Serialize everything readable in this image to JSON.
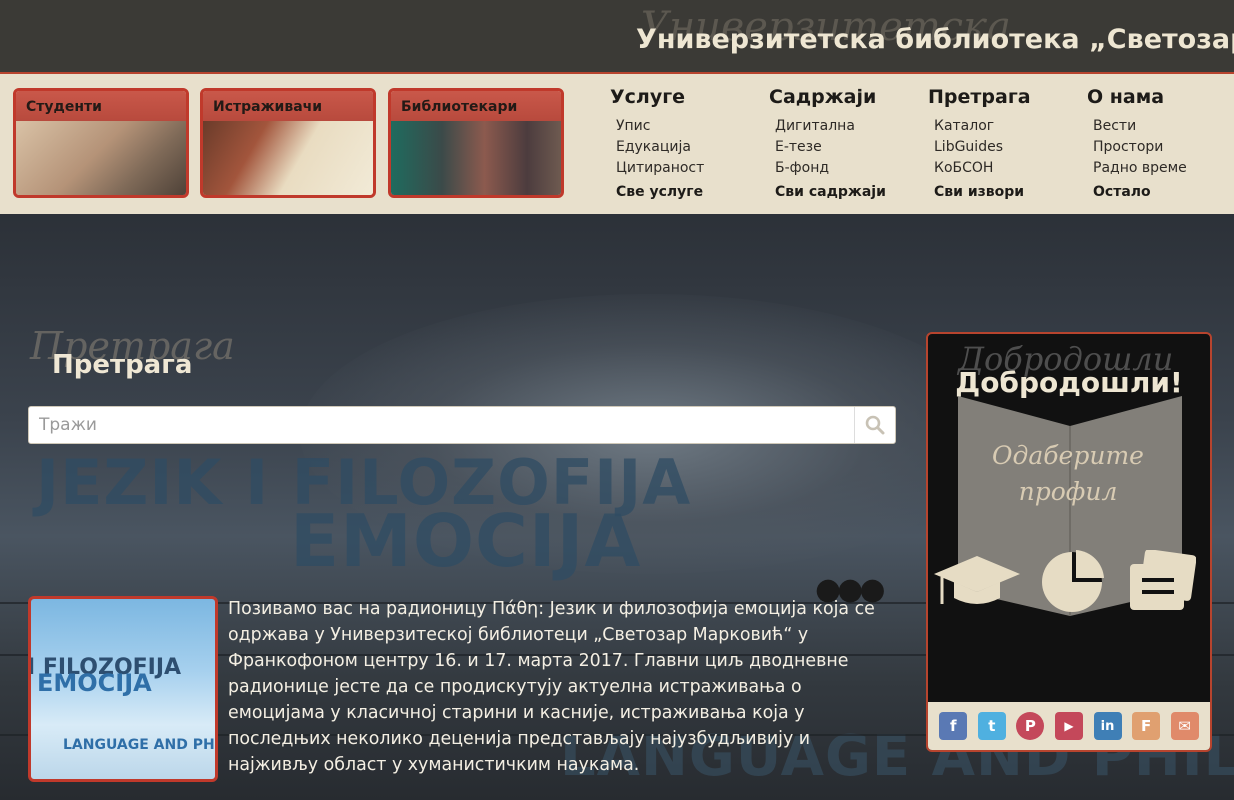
{
  "header": {
    "title": "Универзитетска библиотека „Светозар"
  },
  "profiles": [
    {
      "label": "Студенти"
    },
    {
      "label": "Истраживачи"
    },
    {
      "label": "Библиотекари"
    }
  ],
  "menu": [
    {
      "heading": "Услуге",
      "items": [
        "Упис",
        "Едукација",
        "Цитираност"
      ],
      "more": "Све услуге"
    },
    {
      "heading": "Садржаји",
      "items": [
        "Дигитална",
        "Е-тезе",
        "Б-фонд"
      ],
      "more": "Сви садржаји"
    },
    {
      "heading": "Претрага",
      "items": [
        "Каталог",
        "LibGuides",
        "КоБСОН"
      ],
      "more": "Сви извори"
    },
    {
      "heading": "О нама",
      "items": [
        "Вести",
        "Простори",
        "Радно време"
      ],
      "more": "Остало"
    }
  ],
  "search": {
    "title": "Претрага",
    "placeholder": "Тражи"
  },
  "hero": {
    "line1": "JEZIK I FILOZOFIJA",
    "line2": "EMOCIJA",
    "line3": "LANGUAGE AND PHILOSOPHY"
  },
  "news": {
    "thumb_line1": "I FILOZOFIJA",
    "thumb_line2": "EMOCIJA",
    "thumb_line3": "LANGUAGE AND PHILO",
    "text": "Позивамо вас на радионицу Πάθη: Језик и филозофија емоција која се одржава у Универзитеској библиотеци „Светозар Марковић“ у Франкофоном центру 16. и 17. марта 2017. Главни циљ дводневне радионице јесте да се продискутују актуелна истраживања о емоцијама у класичној старини и касније, истраживања која у последњих неколико деценија представљају најузбудљивију и најживљу област у хуманистичким наукама."
  },
  "welcome": {
    "title": "Добродошли!",
    "choose_line1": "Одаберите",
    "choose_line2": "профил"
  },
  "socials": [
    {
      "icon": "facebook-icon",
      "glyph": "f",
      "color": "#5a79b4"
    },
    {
      "icon": "twitter-icon",
      "glyph": "t",
      "color": "#4fb0e0"
    },
    {
      "icon": "pinterest-icon",
      "glyph": "P",
      "color": "#c4485a"
    },
    {
      "icon": "youtube-icon",
      "glyph": "▶",
      "color": "#c4485a"
    },
    {
      "icon": "linkedin-icon",
      "glyph": "in",
      "color": "#3f7fb6"
    },
    {
      "icon": "foursquare-icon",
      "glyph": "F",
      "color": "#e0a070"
    },
    {
      "icon": "mail-icon",
      "glyph": "✉",
      "color": "#e08a6a"
    }
  ],
  "colors": {
    "accent": "#c0392b",
    "nav_bg": "#e8e0cc",
    "topbar_bg": "#3b3a36"
  }
}
